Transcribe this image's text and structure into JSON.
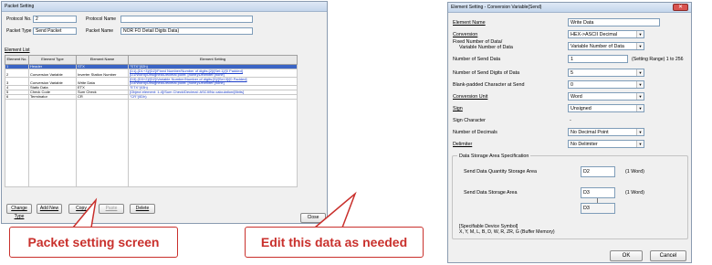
{
  "packet_window": {
    "title": "Packet Setting",
    "protocol_no_label": "Protocol No.",
    "protocol_no_value": "2",
    "protocol_name_label": "Protocol Name",
    "protocol_name_value": "",
    "packet_type_label": "Packet Type",
    "packet_type_value": "Send Packet",
    "packet_name_label": "Packet Name",
    "packet_name_value": "NOR FO Detail Digits Data)",
    "element_list_label": "Element List",
    "columns": [
      "Element No.",
      "Element Type",
      "Element Name",
      "Element Setting"
    ],
    "rows": [
      {
        "no": "1",
        "type": "Header",
        "name": "STX",
        "setting": [
          "\"STX\"(02h)"
        ],
        "selected": true
      },
      {
        "no": "2",
        "type": "Conversion Variable",
        "name": "Inverter Station Number",
        "setting": [
          "[D1]-[D1+3]/[D2]/Fixed Number/Number of digits:[2]/[Sel:1]/[0 Padded]",
          "[D1/Word]/Unsigned/Decimal point: [none]/Delimiter:[none]"
        ],
        "selected": false
      },
      {
        "no": "3",
        "type": "Conversion Variable",
        "name": "Write Data",
        "setting": [
          "[D3]-[D3+2]/[D2]/Variable Number/Number of digits:[5]/[Sel:3]/[0 Padded]",
          "[D3/Word]/Unsigned/Decimal point: [none]/Delimiter:[none]"
        ],
        "selected": false
      },
      {
        "no": "4",
        "type": "Static Data",
        "name": "ETX",
        "setting": [
          "\"ETX\"(03h)"
        ],
        "selected": false
      },
      {
        "no": "5",
        "type": "Check Code",
        "name": "Sum Check",
        "setting": [
          "[Object element: 1-4]/Sum Check/Decimal: ASCII/No calculation/[8bits]"
        ],
        "selected": false
      },
      {
        "no": "6",
        "type": "Terminator",
        "name": "CR",
        "setting": [
          "\"CR\"(0Dh)"
        ],
        "selected": false
      }
    ],
    "buttons": {
      "change_type": "Change Type",
      "add_new": "Add New",
      "copy": "Copy",
      "paste": "Paste",
      "delete": "Delete",
      "close": "Close"
    }
  },
  "dialog": {
    "title": "Element Setting - Conversion Variable(Send)",
    "fields": {
      "element_name": {
        "label": "Element Name",
        "value": "Write Data"
      },
      "conversion": {
        "label": "Conversion",
        "value": "HEX->ASCII Decimal"
      },
      "fixed_number": {
        "label_line1": "Fixed Number of Data/",
        "label_line2": "Variable Number of Data",
        "value": "Variable Number of Data"
      },
      "number_send_data": {
        "label": "Number of Send Data",
        "value": "1",
        "hint": "(Setting Range) 1 to 256"
      },
      "number_send_digits": {
        "label": "Number of Send Digits of Data",
        "value": "5"
      },
      "blank_padded": {
        "label": "Blank-padded Character at Send",
        "value": "0"
      },
      "conversion_unit": {
        "label": "Conversion Unit",
        "value": "Word"
      },
      "sign": {
        "label": "Sign",
        "value": "Unsigned"
      },
      "sign_character": {
        "label": "Sign Character",
        "value": "-"
      },
      "number_decimals": {
        "label": "Number of Decimals",
        "value": "No Decimal Point"
      },
      "delimiter": {
        "label": "Delimiter",
        "value": "No Delimiter"
      }
    },
    "storage": {
      "group_label": "Data Storage Area Specification",
      "quantity_label": "Send Data Quantity Storage Area",
      "quantity_value": "D2",
      "quantity_unit": "(1 Word)",
      "storage_label": "Send Data Storage Area",
      "storage_value": "D3",
      "storage_unit": "(1 Word)",
      "storage_end_value": "D3",
      "device_note_line1": "[Specifiable Device Symbol]",
      "device_note_line2": "X, Y, M, L, B, D, W, R, ZR, G (Buffer Memory)"
    },
    "buttons": {
      "ok": "OK",
      "cancel": "Cancel"
    }
  },
  "callouts": {
    "left": "Packet setting screen",
    "right": "Edit this data as needed"
  },
  "colors": {
    "callout_red": "#c9302c",
    "selected_row": "#3a64c4",
    "link_blue": "#1a3cc8",
    "close_button_red": "#d9534f"
  }
}
